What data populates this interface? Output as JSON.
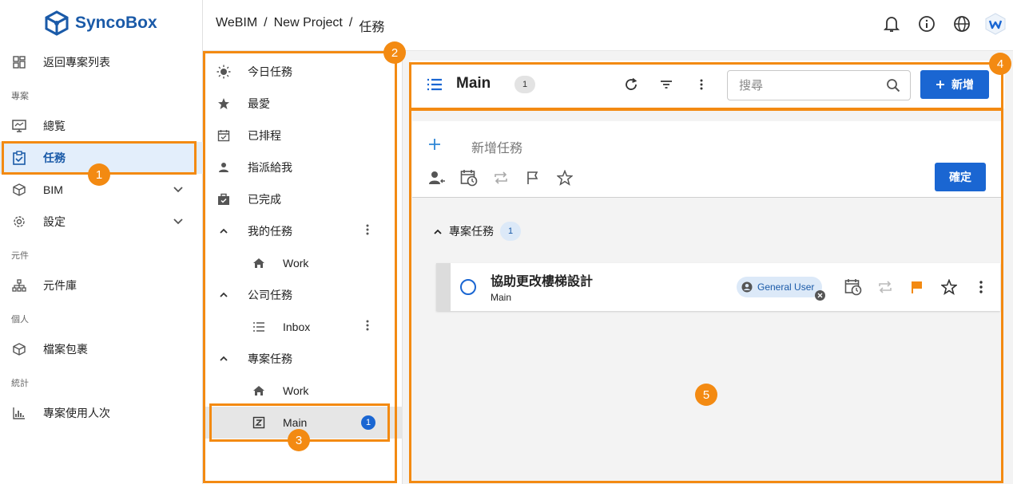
{
  "brand": {
    "name": "SyncoBox"
  },
  "breadcrumb": [
    "WeBIM",
    "/",
    "New Project",
    "/",
    "任務"
  ],
  "topbar_icons": [
    "bell-icon",
    "info-icon",
    "globe-icon",
    "avatar"
  ],
  "sidebar": {
    "back_label": "返回專案列表",
    "sections": [
      "專案",
      "元件",
      "個人",
      "統計"
    ],
    "items": {
      "overview": "總覧",
      "tasks": "任務",
      "bim": "BIM",
      "settings": "設定",
      "component_lib": "元件庫",
      "package": "檔案包裹",
      "usage": "專案使用人次"
    }
  },
  "middle": {
    "today": "今日任務",
    "favorite": "最愛",
    "scheduled": "已排程",
    "assigned": "指派給我",
    "completed": "已完成",
    "my_tasks": "我的任務",
    "my_work": "Work",
    "company_tasks": "公司任務",
    "inbox": "Inbox",
    "project_tasks": "專案任務",
    "project_work": "Work",
    "main": "Main",
    "main_count": "1"
  },
  "toolbar": {
    "title": "Main",
    "count": "1",
    "search_placeholder": "搜尋",
    "new_label": "新增"
  },
  "add_task": {
    "placeholder": "新增任務",
    "confirm_label": "確定"
  },
  "group": {
    "label": "專案任務",
    "count": "1"
  },
  "task": {
    "title": "協助更改樓梯設計",
    "list": "Main",
    "assignee": "General User"
  },
  "annotations": [
    "1",
    "2",
    "3",
    "4",
    "5"
  ],
  "colors": {
    "accent": "#1a66d2",
    "annotation": "#f38a12",
    "flag": "#f38a12"
  }
}
